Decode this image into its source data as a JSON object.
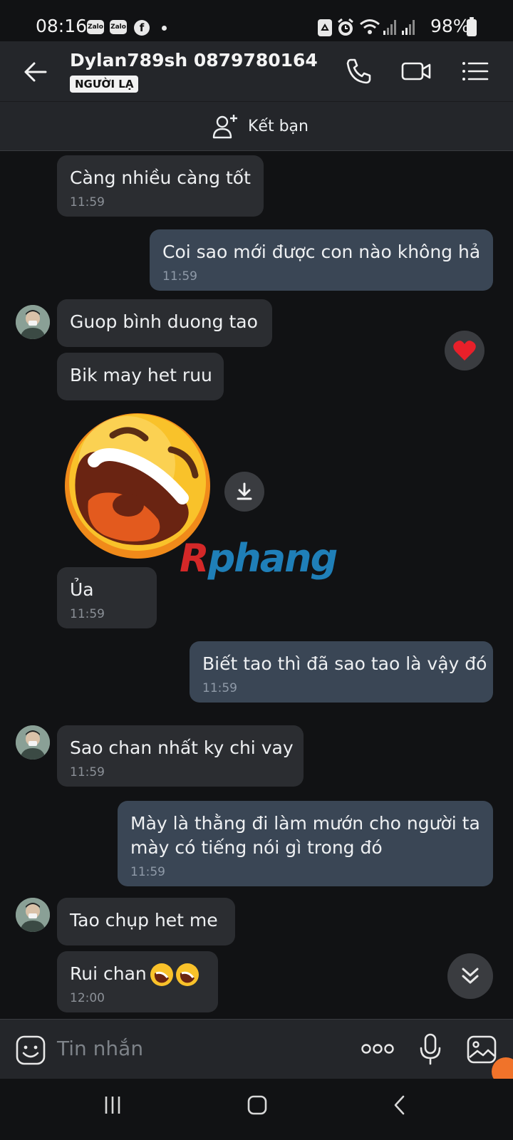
{
  "status_bar": {
    "time": "08:16",
    "app_badges": [
      "Zalo",
      "Zalo"
    ],
    "facebook_badge": "f",
    "battery": "98%"
  },
  "header": {
    "title": "Dylan789sh 0879780164",
    "badge": "NGƯỜI LẠ"
  },
  "add_friend": {
    "label": "Kết bạn"
  },
  "messages": [
    {
      "text": "Càng nhiều càng tốt",
      "time": "11:59"
    },
    {
      "text": "Coi sao mới được con nào không hả",
      "time": "11:59"
    },
    {
      "text": "Guop bình duong tao"
    },
    {
      "text": "Bik may het ruu"
    },
    {
      "text": "Ủa",
      "time": "11:59"
    },
    {
      "text": "Biết tao thì đã sao tao là vậy đó",
      "time": "11:59"
    },
    {
      "text": "Sao chan nhất ky chi vay",
      "time": "11:59"
    },
    {
      "line1": "Mày là thằng đi làm mướn cho người ta",
      "line2": "mày có tiếng nói gì trong đó",
      "time": "11:59"
    },
    {
      "text": "Tao chụp het me"
    },
    {
      "text": "Rui chan",
      "time": "12:00"
    }
  ],
  "watermark": {
    "first": "R",
    "rest": "phang"
  },
  "input": {
    "placeholder": "Tin nhắn"
  },
  "colors": {
    "background": "#111214",
    "header": "#24262a",
    "incoming_bubble": "#2b2d31",
    "outgoing_bubble": "#3a4655",
    "reaction_heart": "#e8202a",
    "emoji_yellow": "#f9c22a"
  },
  "icons": [
    "back-arrow-icon",
    "phone-icon",
    "video-call-icon",
    "menu-list-icon",
    "add-friend-icon",
    "heart-icon",
    "download-icon",
    "chevron-double-down-icon",
    "sticker-icon",
    "more-icon",
    "microphone-icon",
    "image-icon"
  ]
}
